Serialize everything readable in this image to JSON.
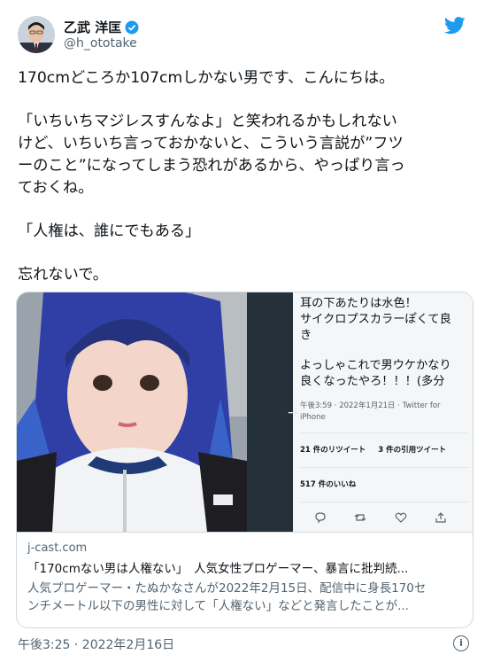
{
  "author": {
    "name": "乙武 洋匡",
    "handle": "@h_ototake"
  },
  "tweet": {
    "lines": [
      "170cmどころか107cmしかない男です、こんにちは。",
      "「いちいちマジレスすんなよ」と笑われるかもしれない",
      "けど、いちいち言っておかないと、こういう言説が”フツ",
      "ーのこと”になってしまう恐れがあるから、やっぱり言っ",
      "ておくね。",
      "「人権は、誰にでもある」",
      "忘れないで。"
    ],
    "timestamp": "午後3:25 · 2022年2月16日"
  },
  "embedded_tweet": {
    "lines": [
      "耳の下あたりは水色！",
      "サイクロプスカラーぽくて良",
      "き",
      "よっしゃこれで男ウケかなり",
      "良くなったやろ！！！(多分"
    ],
    "meta_time": "午後3:59 · 2022年1月21日 · Twitter for",
    "meta_source": "iPhone",
    "retweets": "21 件のリツイート",
    "quotes": "3 件の引用ツイート",
    "likes": "517 件のいいね",
    "arrow": "→"
  },
  "card": {
    "domain": "j-cast.com",
    "title": "「170cmない男は人権ない」　人気女性プロゲーマー、暴言に批判続...",
    "desc1": "人気プロゲーマー・たぬかなさんが2022年2月15日、配信中に身長170セ",
    "desc2": "ンチメートル以下の男性に対して「人権ない」などと発言したことが..."
  },
  "colors": {
    "twitter_blue": "#1d9bf0",
    "hair_blue": "#2f3fa6",
    "text_gray": "#536471"
  },
  "icons": [
    "verified-badge-icon",
    "twitter-bird-icon",
    "reply-icon",
    "retweet-icon",
    "like-icon",
    "share-icon",
    "info-icon"
  ]
}
